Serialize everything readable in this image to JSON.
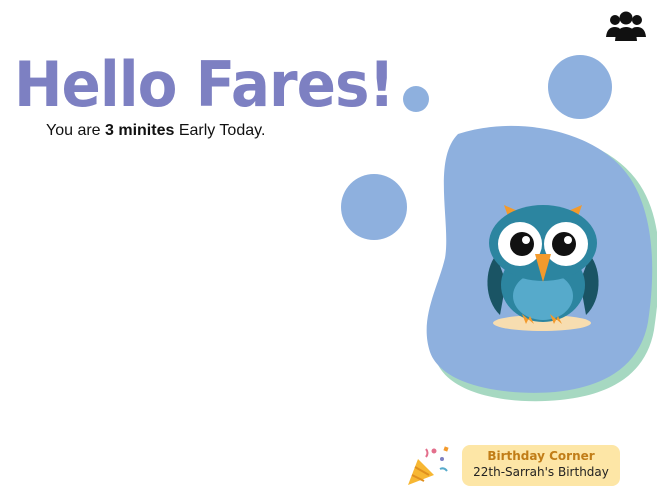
{
  "header": {
    "greeting": "Hello Fares!",
    "status": {
      "prefix": "You are ",
      "highlight": "3 minites",
      "suffix": " Early Today."
    },
    "people_icon": "people-group-icon"
  },
  "illustration": {
    "mascot": "owl",
    "colors": {
      "blob": "#8eb0de",
      "blob_shadow": "#a6d8c1",
      "owl_body": "#2c85a0",
      "owl_wing": "#1a5464",
      "beak": "#f39a2c"
    }
  },
  "birthday_corner": {
    "title": "Birthday Corner",
    "text": "22th-Sarrah's Birthday",
    "icon": "party-popper-icon",
    "background": "#fde6a6"
  }
}
